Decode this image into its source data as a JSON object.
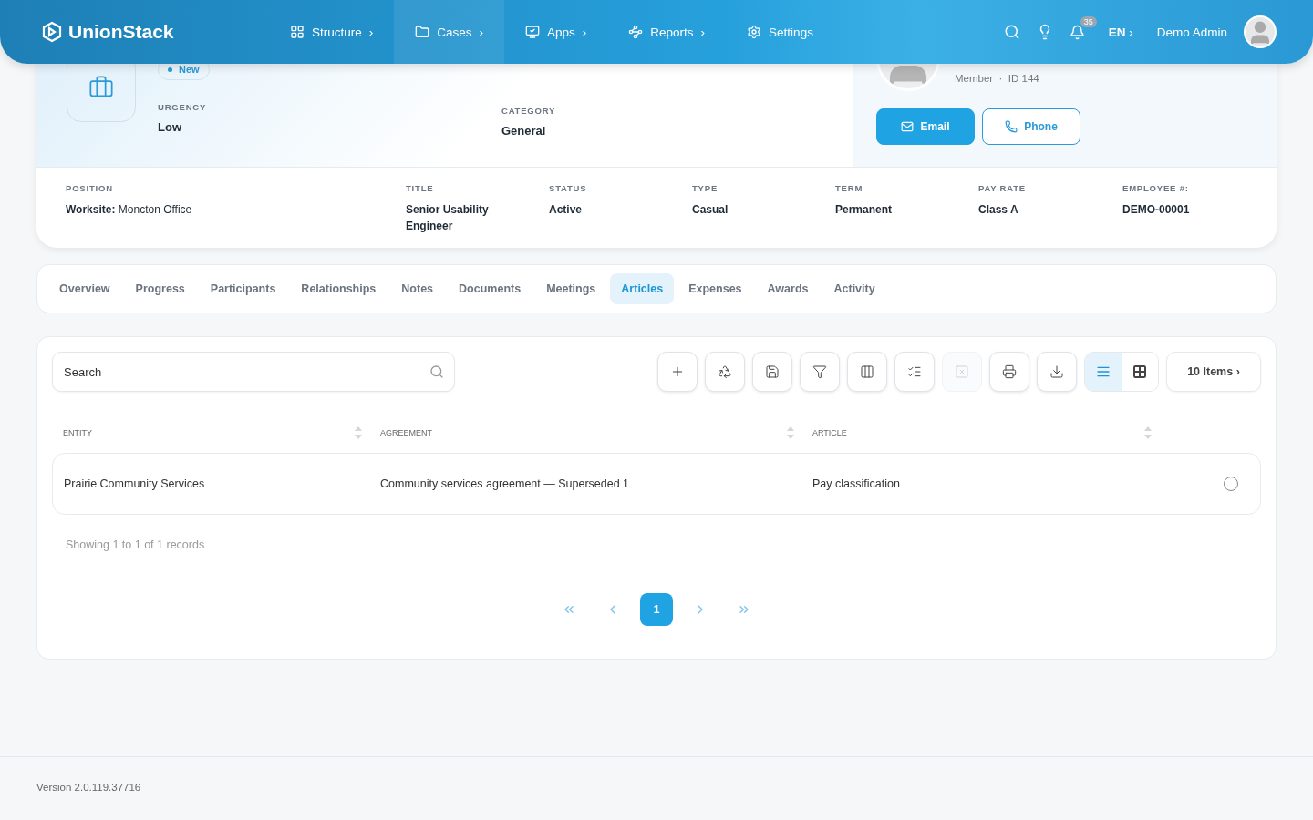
{
  "header": {
    "brand": "UnionStack",
    "nav": [
      {
        "label": "Structure",
        "chevron": "›",
        "selected": false
      },
      {
        "label": "Cases",
        "chevron": "›",
        "selected": true
      },
      {
        "label": "Apps",
        "chevron": "›",
        "selected": false
      },
      {
        "label": "Reports",
        "chevron": "›",
        "selected": false
      },
      {
        "label": "Settings",
        "selected": false
      }
    ],
    "notification_count": "35",
    "language": "EN",
    "language_chevron": "›",
    "user": "Demo Admin"
  },
  "case": {
    "status_badge": "New",
    "fields": [
      {
        "label": "URGENCY",
        "value": "Low"
      },
      {
        "label": "CATEGORY",
        "value": "General"
      }
    ],
    "member": {
      "role": "Member",
      "separator": "·",
      "id": "ID 144",
      "buttons": [
        {
          "label": "Email",
          "kind": "primary"
        },
        {
          "label": "Phone",
          "kind": "outline"
        }
      ]
    }
  },
  "details": [
    {
      "label": "POSITION",
      "prefix": "Worksite:",
      "value": "Moncton Office"
    },
    {
      "label": "TITLE",
      "value": "Senior Usability Engineer"
    },
    {
      "label": "STATUS",
      "value": "Active"
    },
    {
      "label": "TYPE",
      "value": "Casual"
    },
    {
      "label": "TERM",
      "value": "Permanent"
    },
    {
      "label": "PAY RATE",
      "value": "Class A"
    },
    {
      "label": "EMPLOYEE #:",
      "value": "DEMO-00001"
    }
  ],
  "tabs": [
    {
      "label": "Overview",
      "selected": false
    },
    {
      "label": "Progress",
      "selected": false
    },
    {
      "label": "Participants",
      "selected": false
    },
    {
      "label": "Relationships",
      "selected": false
    },
    {
      "label": "Notes",
      "selected": false
    },
    {
      "label": "Documents",
      "selected": false
    },
    {
      "label": "Meetings",
      "selected": false
    },
    {
      "label": "Articles",
      "selected": true
    },
    {
      "label": "Expenses",
      "selected": false
    },
    {
      "label": "Awards",
      "selected": false
    },
    {
      "label": "Activity",
      "selected": false
    }
  ],
  "toolbar": {
    "search": {
      "placeholder": "Search"
    },
    "buttons": [
      {
        "disabled": false
      },
      {
        "disabled": false
      },
      {
        "disabled": false
      },
      {
        "disabled": false
      },
      {
        "disabled": false
      },
      {
        "disabled": false
      },
      {
        "disabled": true
      },
      {
        "disabled": false
      },
      {
        "disabled": false
      }
    ],
    "views": [
      {
        "kind": "list",
        "selected": true
      },
      {
        "kind": "grid",
        "selected": false
      }
    ],
    "page_size": "10 Items",
    "page_size_chevron": "›"
  },
  "table": {
    "columns": [
      "ENTITY",
      "AGREEMENT",
      "ARTICLE"
    ],
    "rows": [
      {
        "cells": [
          "Prairie Community Services",
          "Community services agreement — Superseded 1",
          "Pay classification"
        ],
        "selected": false
      }
    ]
  },
  "summary": "Showing 1 to 1 of 1 records",
  "pagination": {
    "pages": [
      {
        "label": "1",
        "selected": true
      }
    ]
  },
  "footer": {
    "version": "Version 2.0.119.37716"
  }
}
